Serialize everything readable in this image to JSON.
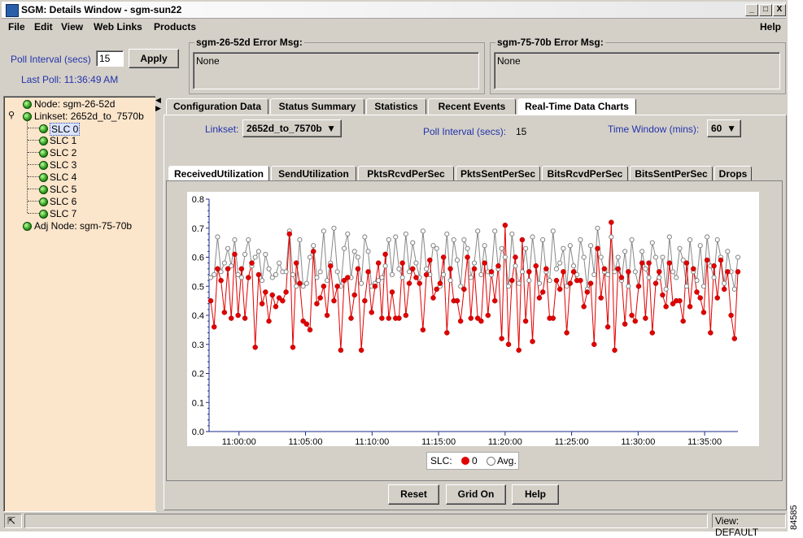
{
  "window": {
    "title": "SGM: Details Window - sgm-sun22",
    "min": "_",
    "max": "□",
    "close": "X"
  },
  "menubar": {
    "items": [
      "File",
      "Edit",
      "View",
      "Web Links",
      "Products"
    ],
    "help": "Help"
  },
  "poll": {
    "label": "Poll Interval (secs)",
    "value": "15",
    "apply": "Apply",
    "last_poll": "Last Poll:  11:36:49 AM"
  },
  "errors": [
    {
      "title": "sgm-26-52d  Error Msg:",
      "text": "None"
    },
    {
      "title": "sgm-75-70b  Error Msg:",
      "text": "None"
    }
  ],
  "tree": {
    "node": "Node: sgm-26-52d",
    "linkset": "Linkset: 2652d_to_7570b",
    "slcs": [
      "SLC 0",
      "SLC 1",
      "SLC 2",
      "SLC 3",
      "SLC 4",
      "SLC 5",
      "SLC 6",
      "SLC 7"
    ],
    "adj": "Adj Node: sgm-75-70b"
  },
  "tabs": [
    "Configuration Data",
    "Status Summary",
    "Statistics",
    "Recent Events",
    "Real-Time Data Charts"
  ],
  "active_tab": "Real-Time Data Charts",
  "controls": {
    "linkset_label": "Linkset:",
    "linkset_value": "2652d_to_7570b",
    "poll_label": "Poll Interval (secs):",
    "poll_value": "15",
    "window_label": "Time Window (mins):",
    "window_value": "60"
  },
  "subtabs": [
    "ReceivedUtilization",
    "SendUtilization",
    "PktsRcvdPerSec",
    "PktsSentPerSec",
    "BitsRcvdPerSec",
    "BitsSentPerSec",
    "Drops"
  ],
  "active_subtab": "ReceivedUtilization",
  "legend": {
    "label": "SLC:",
    "s0": "0",
    "avg": "Avg."
  },
  "buttons": {
    "reset": "Reset",
    "grid": "Grid On",
    "help": "Help"
  },
  "status": {
    "view": "View: DEFAULT"
  },
  "figure_code": "84585",
  "colors": {
    "series0": "#e00000",
    "avg": "#888888",
    "tree_bg": "#fbe5cb",
    "blue_label": "#2233aa"
  },
  "chart_data": {
    "type": "line",
    "x_ticks": [
      "11:00:00",
      "11:05:00",
      "11:10:00",
      "11:15:00",
      "11:20:00",
      "11:25:00",
      "11:30:00",
      "11:35:00"
    ],
    "y_ticks": [
      "0.0",
      "0.1",
      "0.2",
      "0.3",
      "0.4",
      "0.5",
      "0.6",
      "0.7",
      "0.8"
    ],
    "ylim": [
      0,
      0.8
    ],
    "x_range_minutes": [
      -2.25,
      37.5
    ],
    "series": [
      {
        "name": "0",
        "values": [
          0.45,
          0.36,
          0.56,
          0.52,
          0.41,
          0.56,
          0.39,
          0.61,
          0.4,
          0.56,
          0.39,
          0.53,
          0.58,
          0.29,
          0.54,
          0.44,
          0.48,
          0.38,
          0.47,
          0.43,
          0.46,
          0.45,
          0.48,
          0.68,
          0.29,
          0.58,
          0.51,
          0.38,
          0.37,
          0.35,
          0.62,
          0.44,
          0.46,
          0.5,
          0.4,
          0.57,
          0.45,
          0.5,
          0.28,
          0.52,
          0.53,
          0.39,
          0.47,
          0.56,
          0.28,
          0.45,
          0.55,
          0.41,
          0.5,
          0.58,
          0.39,
          0.61,
          0.39,
          0.48,
          0.39,
          0.39,
          0.58,
          0.4,
          0.51,
          0.56,
          0.53,
          0.51,
          0.35,
          0.54,
          0.59,
          0.46,
          0.49,
          0.51,
          0.6,
          0.34,
          0.56,
          0.45,
          0.45,
          0.38,
          0.49,
          0.6,
          0.39,
          0.56,
          0.39,
          0.38,
          0.58,
          0.4,
          0.55,
          0.45,
          0.57,
          0.32,
          0.71,
          0.3,
          0.52,
          0.6,
          0.28,
          0.66,
          0.38,
          0.55,
          0.31,
          0.57,
          0.46,
          0.48,
          0.56,
          0.39,
          0.39,
          0.52,
          0.49,
          0.55,
          0.34,
          0.51,
          0.55,
          0.52,
          0.52,
          0.43,
          0.48,
          0.51,
          0.3,
          0.63,
          0.46,
          0.56,
          0.36,
          0.72,
          0.28,
          0.56,
          0.53,
          0.37,
          0.55,
          0.4,
          0.38,
          0.5,
          0.58,
          0.39,
          0.58,
          0.34,
          0.51,
          0.55,
          0.47,
          0.43,
          0.58,
          0.44,
          0.45,
          0.45,
          0.38,
          0.58,
          0.43,
          0.56,
          0.48,
          0.46,
          0.41,
          0.59,
          0.34,
          0.57,
          0.46,
          0.59,
          0.49,
          0.55,
          0.4,
          0.32,
          0.55
        ]
      },
      {
        "name": "Avg.",
        "values": [
          0.53,
          0.54,
          0.67,
          0.55,
          0.58,
          0.63,
          0.57,
          0.66,
          0.54,
          0.53,
          0.61,
          0.66,
          0.57,
          0.6,
          0.62,
          0.52,
          0.61,
          0.56,
          0.53,
          0.54,
          0.58,
          0.55,
          0.55,
          0.69,
          0.54,
          0.5,
          0.66,
          0.5,
          0.51,
          0.6,
          0.64,
          0.53,
          0.55,
          0.69,
          0.52,
          0.58,
          0.7,
          0.55,
          0.5,
          0.63,
          0.68,
          0.53,
          0.62,
          0.6,
          0.51,
          0.67,
          0.62,
          0.5,
          0.51,
          0.52,
          0.53,
          0.57,
          0.66,
          0.54,
          0.67,
          0.56,
          0.53,
          0.68,
          0.55,
          0.65,
          0.58,
          0.53,
          0.69,
          0.56,
          0.54,
          0.64,
          0.63,
          0.5,
          0.54,
          0.68,
          0.52,
          0.66,
          0.59,
          0.5,
          0.66,
          0.63,
          0.53,
          0.58,
          0.69,
          0.54,
          0.64,
          0.55,
          0.54,
          0.69,
          0.56,
          0.63,
          0.6,
          0.5,
          0.68,
          0.57,
          0.51,
          0.55,
          0.63,
          0.52,
          0.67,
          0.57,
          0.51,
          0.66,
          0.55,
          0.52,
          0.69,
          0.56,
          0.58,
          0.63,
          0.5,
          0.64,
          0.57,
          0.54,
          0.66,
          0.6,
          0.49,
          0.64,
          0.54,
          0.7,
          0.6,
          0.55,
          0.54,
          0.67,
          0.55,
          0.6,
          0.52,
          0.62,
          0.5,
          0.66,
          0.55,
          0.5,
          0.62,
          0.56,
          0.53,
          0.65,
          0.6,
          0.53,
          0.6,
          0.49,
          0.67,
          0.55,
          0.53,
          0.63,
          0.59,
          0.5,
          0.66,
          0.55,
          0.52,
          0.64,
          0.5,
          0.67,
          0.57,
          0.53,
          0.66,
          0.6,
          0.51,
          0.62,
          0.55,
          0.49,
          0.6
        ]
      }
    ]
  }
}
